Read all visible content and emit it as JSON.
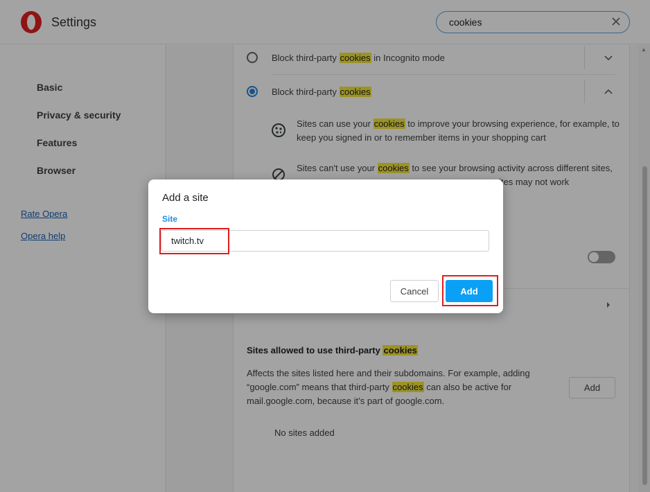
{
  "header": {
    "title": "Settings",
    "search_value": "cookies"
  },
  "sidebar": {
    "items": [
      {
        "label": "Basic"
      },
      {
        "label": "Privacy & security"
      },
      {
        "label": "Features"
      },
      {
        "label": "Browser"
      }
    ],
    "links": [
      {
        "label": "Rate Opera"
      },
      {
        "label": "Opera help"
      }
    ]
  },
  "content": {
    "option_incognito": {
      "prefix": "Block third-party ",
      "highlight": "cookies",
      "suffix": " in Incognito mode",
      "selected": false
    },
    "option_block": {
      "prefix": "Block third-party ",
      "highlight": "cookies",
      "suffix": "",
      "selected": true
    },
    "desc1": {
      "prefix": "Sites can use your ",
      "highlight": "cookies",
      "line1_rest": " to improve your browsing experience, for example, to",
      "line2": "keep you signed in or to remember items in your shopping cart"
    },
    "desc2": {
      "prefix": "Sites can't use your ",
      "highlight": "cookies",
      "rest": " to see your browsing activity across different sites,",
      "line2_tail": "ites may not work"
    },
    "allowed_section": {
      "title_prefix": "Sites allowed to use third-party ",
      "title_highlight": "cookies",
      "desc_line1": "Affects the sites listed here and their subdomains. For example, adding",
      "desc_line2_prefix": "“google.com” means that third-party ",
      "desc_line2_highlight": "cookies",
      "desc_line2_suffix": " can also be active for",
      "desc_line3": "mail.google.com, because it’s part of google.com.",
      "add_label": "Add",
      "empty_text": "No sites added"
    }
  },
  "dialog": {
    "title": "Add a site",
    "field_label": "Site",
    "input_value": "twitch.tv",
    "cancel_label": "Cancel",
    "add_label": "Add"
  },
  "colors": {
    "accent": "#0aa0f6",
    "highlight": "#f5e63b",
    "annotation_red": "#e01b1b"
  }
}
